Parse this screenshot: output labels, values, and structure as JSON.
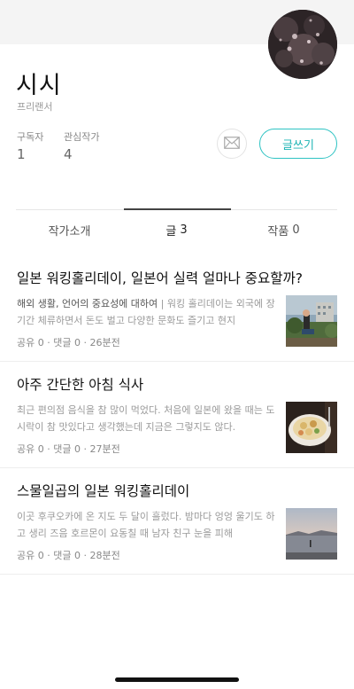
{
  "author": {
    "name": "시시",
    "role": "프리랜서"
  },
  "stats": [
    {
      "label": "구독자",
      "value": "1"
    },
    {
      "label": "관심작가",
      "value": "4"
    }
  ],
  "actions": {
    "write_label": "글쓰기"
  },
  "tabs": [
    {
      "label": "작가소개",
      "count": ""
    },
    {
      "label": "글",
      "count": "3"
    },
    {
      "label": "작품",
      "count": "0"
    }
  ],
  "posts": [
    {
      "title": "일본 워킹홀리데이, 일본어 실력 얼마나 중요할까?",
      "subtitle": "해외 생활, 언어의 중요성에 대하여",
      "separator": " | ",
      "excerpt": "워킹 홀리데이는 외국에 장기간 체류하면서 돈도 벌고 다양한 문화도 즐기고 현지",
      "meta": "공유 0 · 댓글 0 · 26분전"
    },
    {
      "title": "아주 간단한 아침 식사",
      "subtitle": "",
      "separator": "",
      "excerpt": "최근 편의점 음식을 참 많이 먹었다. 처음에 일본에 왔을 때는 도시락이 참 맛있다고 생각했는데 지금은 그렇지도 않다.",
      "meta": "공유 0 · 댓글 0 · 27분전"
    },
    {
      "title": "스물일곱의 일본 워킹홀리데이",
      "subtitle": "",
      "separator": "",
      "excerpt": "이곳 후쿠오카에 온 지도 두 달이 흘렀다. 밤마다 엉엉 울기도 하고 생리 즈음 호르몬이 요동칠 때 남자 친구 눈을 피해",
      "meta": "공유 0 · 댓글 0 · 28분전"
    }
  ],
  "icons": {
    "mail": "mail-icon"
  },
  "colors": {
    "accent": "#1fb5b5"
  }
}
